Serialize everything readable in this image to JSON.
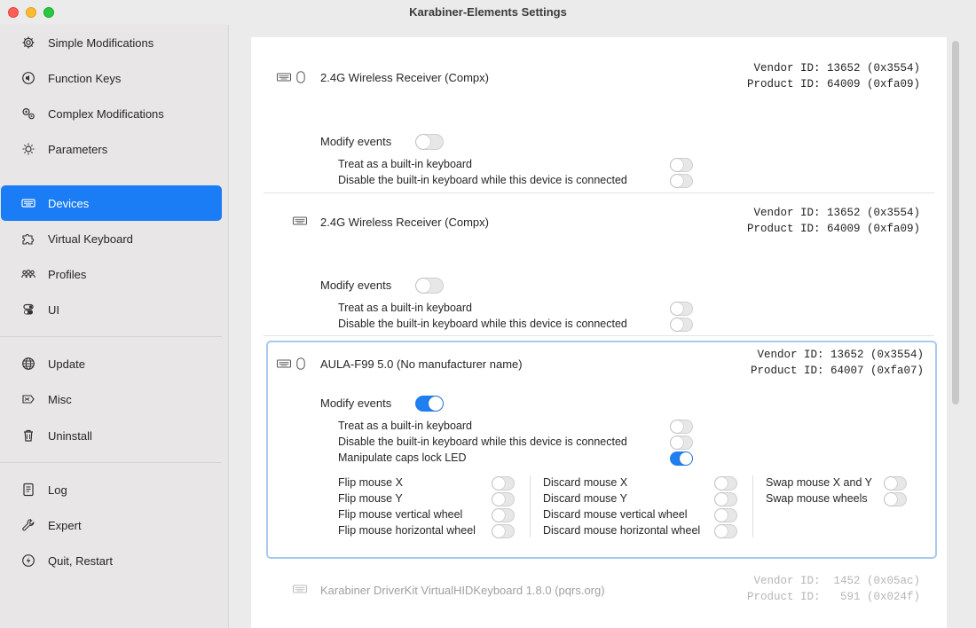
{
  "window": {
    "title": "Karabiner-Elements Settings"
  },
  "sidebar": {
    "items": [
      {
        "label": "Simple Modifications",
        "icon": "gear-icon"
      },
      {
        "label": "Function Keys",
        "icon": "speaker-icon"
      },
      {
        "label": "Complex Modifications",
        "icon": "gears-icon"
      },
      {
        "label": "Parameters",
        "icon": "sun-icon"
      },
      {
        "label": "Devices",
        "icon": "keyboard-icon",
        "selected": true
      },
      {
        "label": "Virtual Keyboard",
        "icon": "puzzle-icon"
      },
      {
        "label": "Profiles",
        "icon": "people-icon"
      },
      {
        "label": "UI",
        "icon": "switches-icon"
      },
      {
        "label": "Update",
        "icon": "globe-icon"
      },
      {
        "label": "Misc",
        "icon": "misc-icon"
      },
      {
        "label": "Uninstall",
        "icon": "trash-icon"
      },
      {
        "label": "Log",
        "icon": "document-icon"
      },
      {
        "label": "Expert",
        "icon": "wrench-icon"
      },
      {
        "label": "Quit, Restart",
        "icon": "power-icon"
      }
    ]
  },
  "common": {
    "modify_events": "Modify events",
    "treat_builtin": "Treat as a built-in keyboard",
    "disable_builtin": "Disable the built-in keyboard while this device is connected",
    "caps_lock_led": "Manipulate caps lock LED",
    "flip_x": "Flip mouse X",
    "flip_y": "Flip mouse Y",
    "flip_vwheel": "Flip mouse vertical wheel",
    "flip_hwheel": "Flip mouse horizontal wheel",
    "discard_x": "Discard mouse X",
    "discard_y": "Discard mouse Y",
    "discard_vwheel": "Discard mouse vertical wheel",
    "discard_hwheel": "Discard mouse horizontal wheel",
    "swap_xy": "Swap mouse X and Y",
    "swap_wheels": "Swap mouse wheels"
  },
  "devices": [
    {
      "name": "2.4G Wireless Receiver (Compx)",
      "vendor": "Vendor ID: 13652 (0x3554)",
      "product": "Product ID: 64009 (0xfa09)",
      "modify_events": false,
      "treat_builtin": false,
      "disable_builtin": false
    },
    {
      "name": "2.4G Wireless Receiver (Compx)",
      "vendor": "Vendor ID: 13652 (0x3554)",
      "product": "Product ID: 64009 (0xfa09)",
      "modify_events": false,
      "treat_builtin": false,
      "disable_builtin": false
    },
    {
      "name": "AULA-F99 5.0  (No manufacturer name)",
      "vendor": "Vendor ID: 13652 (0x3554)",
      "product": "Product ID: 64007 (0xfa07)",
      "modify_events": true,
      "treat_builtin": false,
      "disable_builtin": false,
      "caps_lock_led": true
    },
    {
      "name": "Karabiner DriverKit VirtualHIDKeyboard 1.8.0 (pqrs.org)",
      "vendor": "Vendor ID:  1452 (0x05ac)",
      "product": "Product ID:   591 (0x024f)"
    }
  ],
  "colors": {
    "accent": "#1a7df6",
    "toggle_on": "#1f7ef0"
  }
}
